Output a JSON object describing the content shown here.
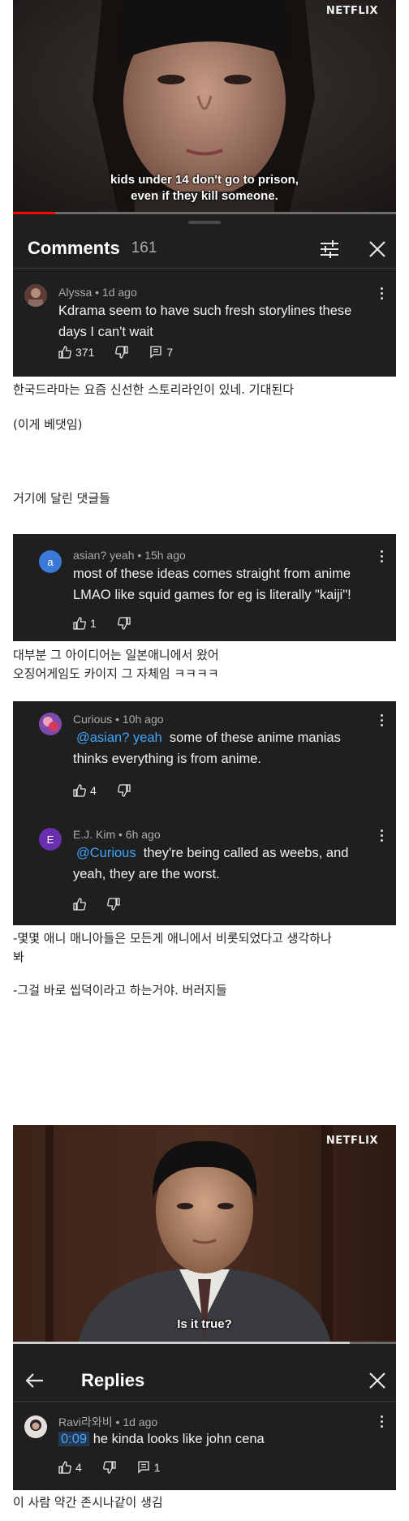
{
  "video1": {
    "watermark": "NETFLIX",
    "subtitle_line1": "kids under 14 don't go to prison,",
    "subtitle_line2": "even if they kill someone.",
    "progress": 0.11
  },
  "comments_panel": {
    "title": "Comments",
    "count": "161",
    "filter_icon": "sliders-icon",
    "close_icon": "close-icon"
  },
  "comment1": {
    "author_meta": "Alyssa • 1d ago",
    "text_line1": "Kdrama seem to have such fresh storylines these",
    "text_line2": "days I can't wait",
    "likes": "371",
    "replies": "7"
  },
  "kr1": {
    "line1": "한국드라마는 요즘 신선한 스토리라인이 있네. 기대된다",
    "line2": "(이게 베댓임)",
    "line3": "거기에 달린 댓글들"
  },
  "reply1": {
    "avatar_letter": "a",
    "author_meta": "asian? yeah • 15h ago",
    "text_line1": "most of these ideas comes straight from anime",
    "text_line2": "LMAO like squid games for eg is literally \"kaiji\"!",
    "likes": "1"
  },
  "kr2": {
    "line1": "대부분 그 아이디어는 일본애니에서 왔어",
    "line2": "오징어게임도 카이지 그 자체임 ㅋㅋㅋㅋ"
  },
  "reply2": {
    "author_meta": "Curious • 10h ago",
    "mention": "@asian? yeah",
    "text_line1_rest": "some of these anime manias",
    "text_line2": "thinks everything is from anime.",
    "likes": "4"
  },
  "reply3": {
    "avatar_letter": "E",
    "author_meta": "E.J. Kim • 6h ago",
    "mention": "@Curious",
    "text_line1_rest": "they're being called as weebs, and",
    "text_line2": "yeah, they are the worst."
  },
  "kr3": {
    "line1": "-몇몇 애니 매니아들은 모든게 애니에서 비롯되었다고 생각하나",
    "line2": "봐",
    "line3": "-그걸 바로 씹덕이라고 하는거야. 버러지들"
  },
  "video2": {
    "watermark": "NETFLIX",
    "subtitle": "Is it true?",
    "progress": 0.88
  },
  "replies_panel": {
    "title": "Replies",
    "back_icon": "back-arrow-icon",
    "close_icon": "close-icon"
  },
  "comment_ravi": {
    "author_meta": "Ravi라와비 • 1d ago",
    "timestamp": "0:09",
    "text_rest": "he kinda looks like john cena",
    "likes": "4",
    "replies": "1"
  },
  "kr4": {
    "line1": "이 사람 약간 존시나같이 생김"
  },
  "colors": {
    "panel_bg": "#1f1f1f",
    "mention_blue": "#3ea6ff",
    "progress_red": "#ff0000"
  }
}
